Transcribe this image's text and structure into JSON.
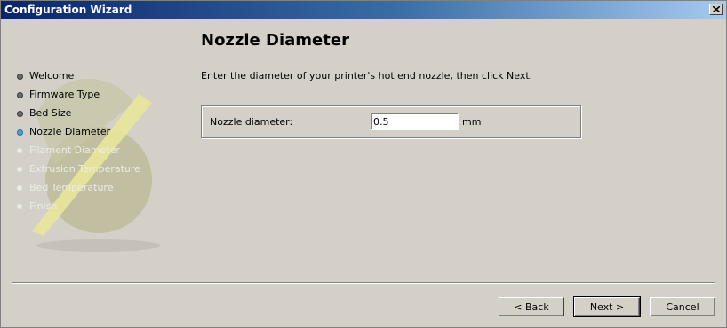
{
  "window": {
    "title": "Configuration Wizard"
  },
  "sidebar": {
    "steps": [
      {
        "label": "Welcome",
        "state": "done"
      },
      {
        "label": "Firmware Type",
        "state": "done"
      },
      {
        "label": "Bed Size",
        "state": "done"
      },
      {
        "label": "Nozzle Diameter",
        "state": "active"
      },
      {
        "label": "Filament Diameter",
        "state": "todo"
      },
      {
        "label": "Extrusion Temperature",
        "state": "todo"
      },
      {
        "label": "Bed Temperature",
        "state": "todo"
      },
      {
        "label": "Finish",
        "state": "todo"
      }
    ]
  },
  "page": {
    "title": "Nozzle Diameter",
    "instruction": "Enter the diameter of your printer's hot end nozzle, then click Next.",
    "field": {
      "label": "Nozzle diameter:",
      "value": "0.5",
      "unit": "mm"
    }
  },
  "buttons": {
    "back": "< Back",
    "next": "Next >",
    "cancel": "Cancel"
  },
  "colors": {
    "title_bar": "#0a246a",
    "active_step": "#4aa0d8",
    "window_bg": "#d4d0c8"
  }
}
